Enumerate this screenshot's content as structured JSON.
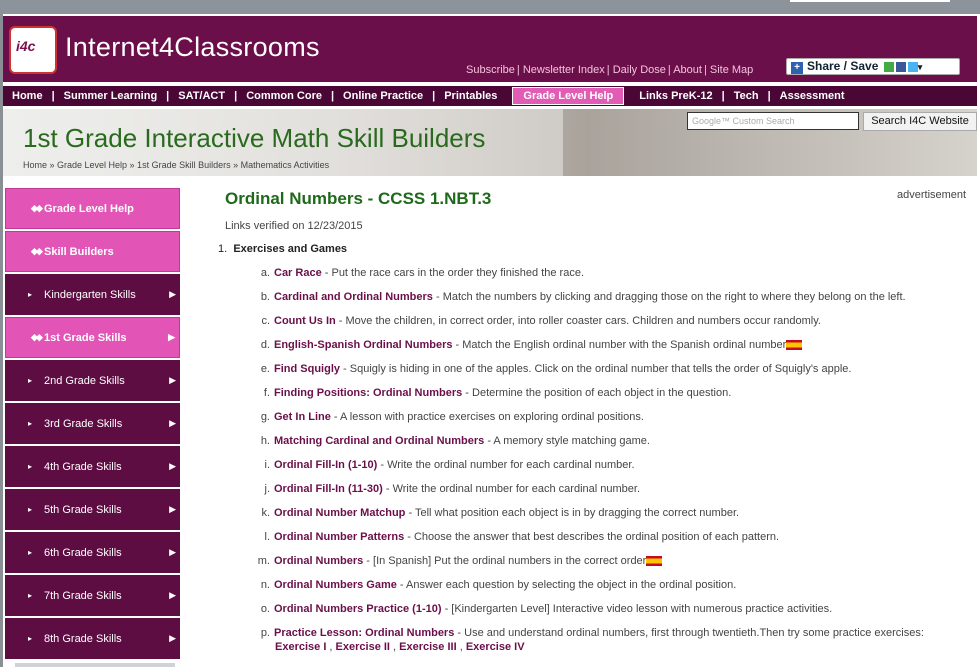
{
  "site": {
    "title": "Internet4Classrooms",
    "logo_text": "i4c"
  },
  "top_links": [
    "Subscribe",
    "Newsletter Index",
    "Daily Dose",
    "About",
    "Site Map"
  ],
  "share_label": "Share / Save",
  "nav": [
    "Home",
    "Summer Learning",
    "SAT/ACT",
    "Common Core",
    "Online Practice",
    "Printables",
    "Grade Level Help",
    "Links PreK-12",
    "Tech",
    "Assessment"
  ],
  "banner": {
    "title": "1st Grade Interactive Math Skill Builders",
    "breadcrumb": "Home  »  Grade Level Help  »  1st Grade Skill Builders  »  Mathematics Activities",
    "search_placeholder": "Google™ Custom Search",
    "search_button": "Search I4C Website"
  },
  "sidebar": [
    {
      "label": "Grade Level Help",
      "style": "pink"
    },
    {
      "label": "Skill Builders",
      "style": "pink"
    },
    {
      "label": "Kindergarten Skills",
      "style": "dark"
    },
    {
      "label": "1st Grade Skills",
      "style": "pink"
    },
    {
      "label": "2nd Grade Skills",
      "style": "dark"
    },
    {
      "label": "3rd Grade Skills",
      "style": "dark"
    },
    {
      "label": "4th Grade Skills",
      "style": "dark"
    },
    {
      "label": "5th Grade Skills",
      "style": "dark"
    },
    {
      "label": "6th Grade Skills",
      "style": "dark"
    },
    {
      "label": "7th Grade Skills",
      "style": "dark"
    },
    {
      "label": "8th Grade Skills",
      "style": "dark"
    }
  ],
  "main": {
    "heading": "Ordinal Numbers - CCSS 1.NBT.3",
    "advertisement": "advertisement",
    "verified": "Links verified on 12/23/2015",
    "list_number": "1.",
    "list_title": "Exercises and Games",
    "items": [
      {
        "letter": "a.",
        "link": "Car Race",
        "desc": " - Put the race cars in the order they finished the race.",
        "flag": false
      },
      {
        "letter": "b.",
        "link": "Cardinal and Ordinal Numbers",
        "desc": "  - Match the numbers by clicking and dragging those on the right to where they belong on the left.",
        "flag": false
      },
      {
        "letter": "c.",
        "link": "Count Us In",
        "desc": "  - Move the children, in correct order, into roller coaster cars. Children and numbers occur randomly.",
        "flag": false
      },
      {
        "letter": "d.",
        "link": "English-Spanish Ordinal Numbers",
        "desc": "  - Match the English ordinal number with the Spanish ordinal number",
        "flag": true
      },
      {
        "letter": "e.",
        "link": "Find Squigly",
        "desc": "  - Squigly is hiding in one of the apples. Click on the ordinal number that tells the order of Squigly's apple.",
        "flag": false
      },
      {
        "letter": "f.",
        "link": "Finding Positions: Ordinal Numbers",
        "desc": "   - Determine the position of each object in the question.",
        "flag": false
      },
      {
        "letter": "g.",
        "link": "Get In Line",
        "desc": "  - A lesson with practice exercises on exploring ordinal positions.",
        "flag": false
      },
      {
        "letter": "h.",
        "link": "Matching Cardinal and Ordinal Numbers",
        "desc": "   - A memory style matching game.",
        "flag": false
      },
      {
        "letter": "i.",
        "link": "Ordinal Fill-In (1-10)",
        "desc": "  - Write the ordinal number for each cardinal number.",
        "flag": false
      },
      {
        "letter": "j.",
        "link": "Ordinal Fill-In (11-30)",
        "desc": "  - Write the ordinal number for each cardinal number.",
        "flag": false
      },
      {
        "letter": "k.",
        "link": "Ordinal Number Matchup",
        "desc": "  - Tell what position each object is in by dragging the correct number.",
        "flag": false
      },
      {
        "letter": "l.",
        "link": "Ordinal Number Patterns",
        "desc": "  - Choose the answer that best describes the ordinal position of each pattern.",
        "flag": false
      },
      {
        "letter": "m.",
        "link": "Ordinal Numbers",
        "desc": "  - [In Spanish] Put the ordinal numbers in the correct order",
        "flag": true
      },
      {
        "letter": "n.",
        "link": "Ordinal Numbers Game",
        "desc": "  - Answer each question by selecting the object in the ordinal position.",
        "flag": false
      },
      {
        "letter": "o.",
        "link": "Ordinal Numbers Practice (1-10)",
        "desc": "  - [Kindergarten Level] Interactive video lesson with numerous practice activities.",
        "flag": false
      },
      {
        "letter": "p.",
        "link": "Practice Lesson: Ordinal Numbers",
        "desc": "  - Use and understand ordinal numbers, first through twentieth.Then try some practice exercises:",
        "flag": false
      }
    ],
    "exercises": [
      "Exercise I",
      "Exercise II",
      "Exercise III",
      "Exercise IV"
    ]
  },
  "colors": {
    "maroon": "#6b0f4a",
    "pink": "#e254b6",
    "green": "#1f6a1a"
  }
}
